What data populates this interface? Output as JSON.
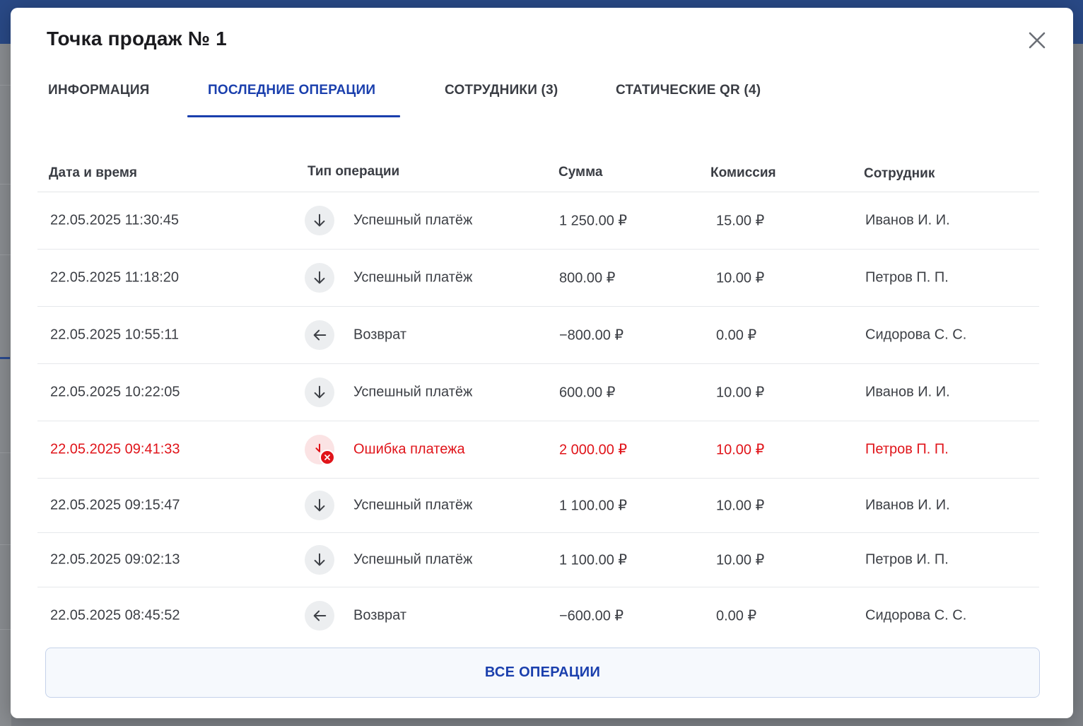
{
  "modal": {
    "title": "Точка продаж № 1"
  },
  "tabs": [
    {
      "label": "ИНФОРМАЦИЯ",
      "active": false
    },
    {
      "label": "ПОСЛЕДНИЕ ОПЕРАЦИИ",
      "active": true
    },
    {
      "label": "СОТРУДНИКИ (3)",
      "active": false
    },
    {
      "label": "СТАТИЧЕСКИЕ QR (4)",
      "active": false
    }
  ],
  "table": {
    "headers": {
      "date": "Дата и время",
      "type": "Тип операции",
      "sum": "Сумма",
      "fee": "Комиссия",
      "employee": "Сотрудник"
    },
    "rows": [
      {
        "date": "22.05.2025 11:30:45",
        "icon": "arrow-down-icon",
        "type": "Успешный платёж",
        "sum": "1 250.00 ₽",
        "fee": "15.00 ₽",
        "employee": "Иванов И. И."
      },
      {
        "date": "22.05.2025 11:18:20",
        "icon": "arrow-down-icon",
        "type": "Успешный платёж",
        "sum": "800.00 ₽",
        "fee": "10.00 ₽",
        "employee": "Петров П. П."
      },
      {
        "date": "22.05.2025 10:55:11",
        "icon": "arrow-left-icon",
        "type": "Возврат",
        "sum": "−800.00 ₽",
        "fee": "0.00 ₽",
        "employee": "Сидорова С. С."
      },
      {
        "date": "22.05.2025 10:22:05",
        "icon": "arrow-down-icon",
        "type": "Успешный платёж",
        "sum": "600.00 ₽",
        "fee": "10.00 ₽",
        "employee": "Иванов И. И."
      },
      {
        "date": "22.05.2025 09:41:33",
        "icon": "error-icon",
        "type": "Ошибка платежа",
        "sum": "2 000.00 ₽",
        "fee": "10.00 ₽",
        "employee": "Петров П. П."
      },
      {
        "date": "22.05.2025 09:15:47",
        "icon": "arrow-down-icon",
        "type": "Успешный платёж",
        "sum": "1 100.00 ₽",
        "fee": "10.00 ₽",
        "employee": "Иванов И. И."
      },
      {
        "date": "22.05.2025 09:02:13",
        "icon": "arrow-down-icon",
        "type": "Успешный платёж",
        "sum": "1 100.00 ₽",
        "fee": "10.00 ₽",
        "employee": "Петров И. П."
      },
      {
        "date": "22.05.2025 08:45:52",
        "icon": "arrow-left-icon",
        "type": "Возврат",
        "sum": "−600.00 ₽",
        "fee": "0.00 ₽",
        "employee": "Сидорова С. С."
      }
    ]
  },
  "footer": {
    "all_operations_label": "ВСЕ ОПЕРАЦИИ"
  },
  "colors": {
    "accent": "#1a3fad",
    "error": "#e0141a",
    "text": "#3c3f45"
  }
}
